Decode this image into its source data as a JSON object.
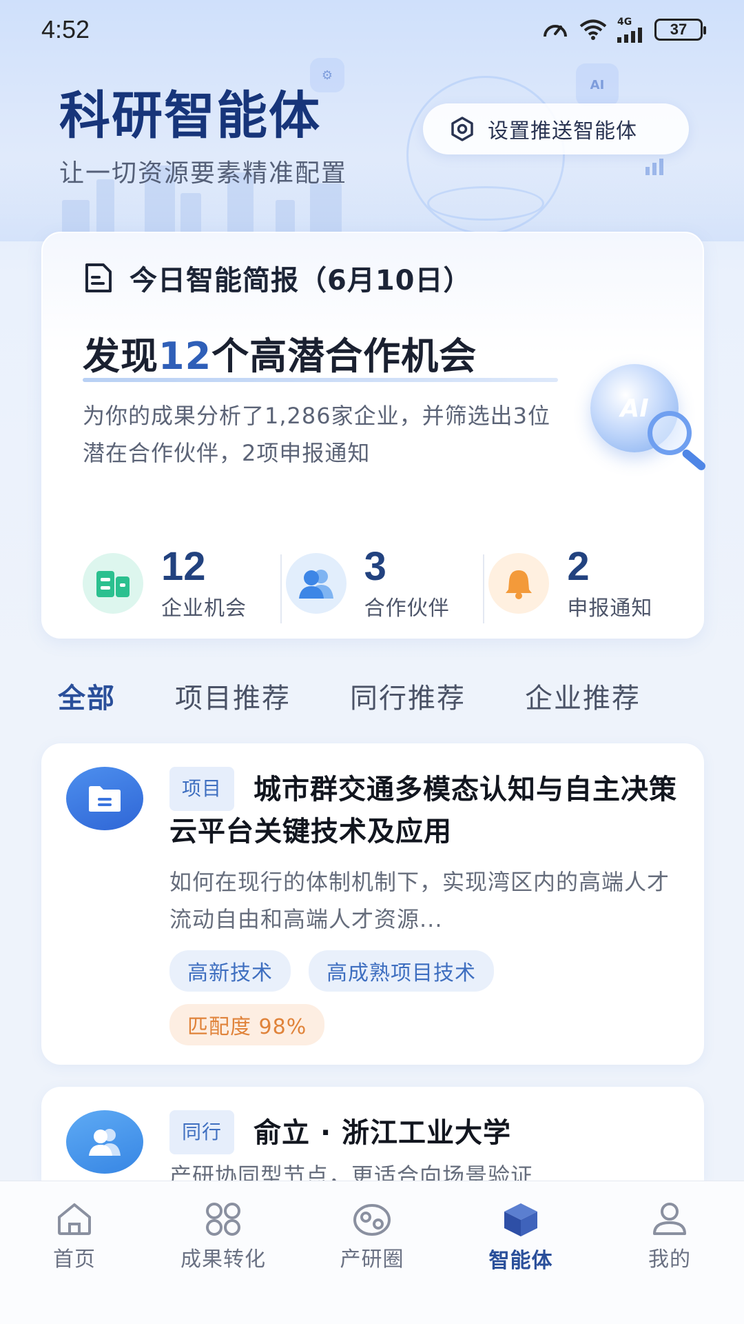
{
  "status_bar": {
    "time": "4:52",
    "network": "4G",
    "battery": "37"
  },
  "header": {
    "title": "科研智能体",
    "subtitle": "让一切资源要素精准配置",
    "push_button_label": "设置推送智能体"
  },
  "brief": {
    "title": "今日智能简报（6月10日）",
    "headline_pre": "发现",
    "headline_num": "12",
    "headline_post": "个高潜合作机会",
    "description": "为你的成果分析了1,286家企业，并筛选出3位潜在合作伙伴，2项申报通知",
    "badge_text": "AI",
    "stats": [
      {
        "value": "12",
        "label": "企业机会",
        "icon": "building-icon",
        "color": "#2bc08f"
      },
      {
        "value": "3",
        "label": "合作伙伴",
        "icon": "users-icon",
        "color": "#4a8fe8"
      },
      {
        "value": "2",
        "label": "申报通知",
        "icon": "bell-icon",
        "color": "#f39a3a"
      }
    ]
  },
  "tabs": [
    {
      "label": "全部",
      "active": true
    },
    {
      "label": "项目推荐",
      "active": false
    },
    {
      "label": "同行推荐",
      "active": false
    },
    {
      "label": "企业推荐",
      "active": false
    }
  ],
  "recommendations": [
    {
      "type_badge": "项目",
      "title": "城市群交通多模态认知与自主决策云平台关键技术及应用",
      "description": "如何在现行的体制机制下，实现湾区内的高端人才流动自由和高端人才资源...",
      "tags": [
        "高新技术",
        "高成熟项目技术"
      ],
      "match": "匹配度 98%",
      "icon": "folder-icon"
    },
    {
      "type_badge": "同行",
      "title": "俞立 · 浙江工业大学",
      "description": "产研协同型节点，更适合向场景验证",
      "icon": "users-icon"
    }
  ],
  "bottom_nav": [
    {
      "label": "首页",
      "icon": "home-icon",
      "active": false
    },
    {
      "label": "成果转化",
      "icon": "grid-icon",
      "active": false
    },
    {
      "label": "产研圈",
      "icon": "community-icon",
      "active": false
    },
    {
      "label": "智能体",
      "icon": "cube-icon",
      "active": true
    },
    {
      "label": "我的",
      "icon": "user-icon",
      "active": false
    }
  ]
}
